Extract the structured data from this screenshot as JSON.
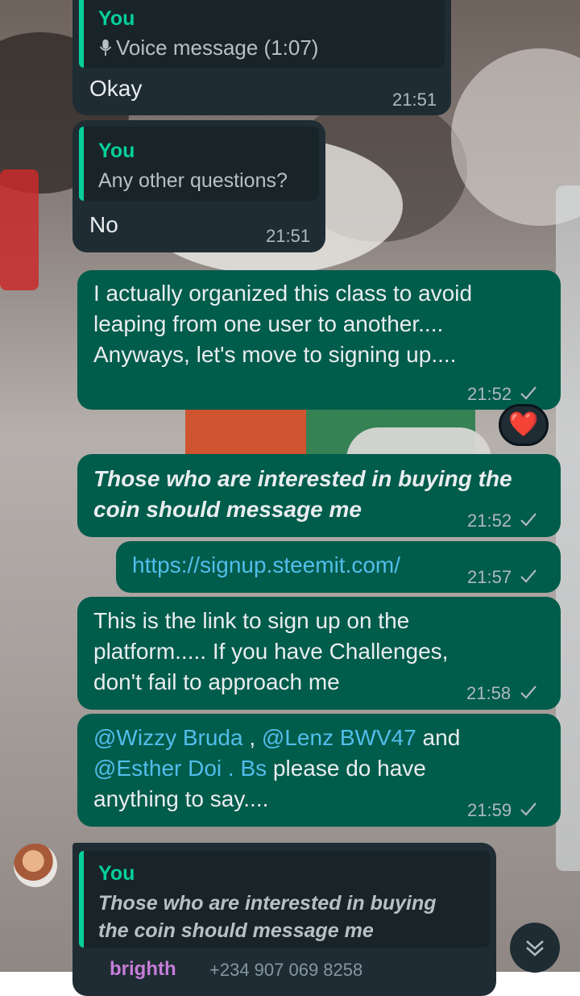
{
  "chat": {
    "messages": [
      {
        "direction": "incoming",
        "quote_author": "You",
        "quote_text": "Voice message (1:07)",
        "quote_icon": "mic-icon",
        "text": "Okay",
        "time": "21:51"
      },
      {
        "direction": "incoming",
        "quote_author": "You",
        "quote_text": "Any other questions?",
        "text": "No",
        "time": "21:51"
      },
      {
        "direction": "outgoing",
        "lines": [
          "I actually organized this class to avoid",
          "leaping from one user to another....",
          "Anyways, let's move to signing up...."
        ],
        "time": "21:52",
        "status": "sent",
        "reaction": "❤️"
      },
      {
        "direction": "outgoing",
        "lines": [
          "Those who are interested in buying the",
          "coin should message me"
        ],
        "time": "21:52",
        "status": "sent"
      },
      {
        "direction": "outgoing",
        "link": "https://signup.steemit.com/",
        "time": "21:57",
        "status": "sent"
      },
      {
        "direction": "outgoing",
        "lines": [
          "This is the link to sign up on the",
          "platform..... If you have Challenges,",
          "don't fail to approach me"
        ],
        "time": "21:58",
        "status": "sent"
      },
      {
        "direction": "outgoing",
        "mention1": "@Wizzy Bruda",
        "sep1": " , ",
        "mention2": "@Lenz BWV47",
        "after2": " and",
        "mention3": "@Esther Doi . Bs",
        "after3": " please do have",
        "line3": "anything to say....",
        "time": "21:59",
        "status": "sent"
      },
      {
        "direction": "incoming",
        "quote_author": "You",
        "quote_lines": [
          "Those who are interested in buying",
          "the coin should message me"
        ],
        "partial_name": "brighth",
        "partial_phone": "+234 907 069 8258"
      }
    ]
  },
  "colors": {
    "incoming_bubble": "#1f2c33",
    "outgoing_bubble": "#005c4b",
    "accent": "#06cf9c",
    "link": "#53bdeb"
  }
}
